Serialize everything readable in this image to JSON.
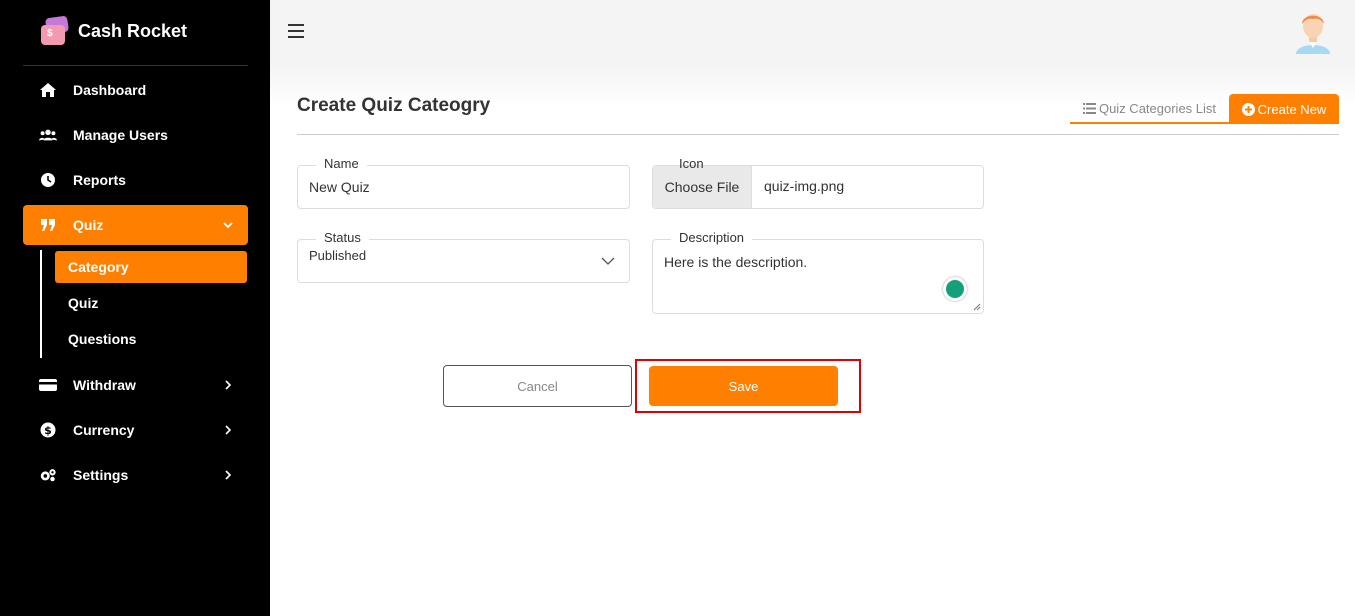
{
  "app": {
    "name": "Cash Rocket"
  },
  "sidebar": {
    "items": [
      {
        "label": "Dashboard",
        "icon": "home-icon"
      },
      {
        "label": "Manage Users",
        "icon": "users-icon"
      },
      {
        "label": "Reports",
        "icon": "clock-icon"
      },
      {
        "label": "Quiz",
        "icon": "quote-icon",
        "expanded": true
      },
      {
        "label": "Withdraw",
        "icon": "credit-card-icon"
      },
      {
        "label": "Currency",
        "icon": "dollar-circle-icon"
      },
      {
        "label": "Settings",
        "icon": "gears-icon"
      }
    ],
    "quiz_subitems": [
      {
        "label": "Category",
        "active": true
      },
      {
        "label": "Quiz"
      },
      {
        "label": "Questions"
      }
    ]
  },
  "page": {
    "title": "Create Quiz Cateogry",
    "tabs": {
      "list_label": "Quiz Categories List",
      "create_label": "Create New"
    }
  },
  "form": {
    "name": {
      "label": "Name",
      "value": "New Quiz"
    },
    "icon": {
      "label": "Icon",
      "button": "Choose File",
      "file": "quiz-img.png"
    },
    "status": {
      "label": "Status",
      "value": "Published"
    },
    "description": {
      "label": "Description",
      "value": "Here is the description."
    },
    "cancel_label": "Cancel",
    "save_label": "Save"
  },
  "colors": {
    "accent": "#ff8000",
    "sidebar_bg": "#000000",
    "highlight": "#e00000"
  }
}
